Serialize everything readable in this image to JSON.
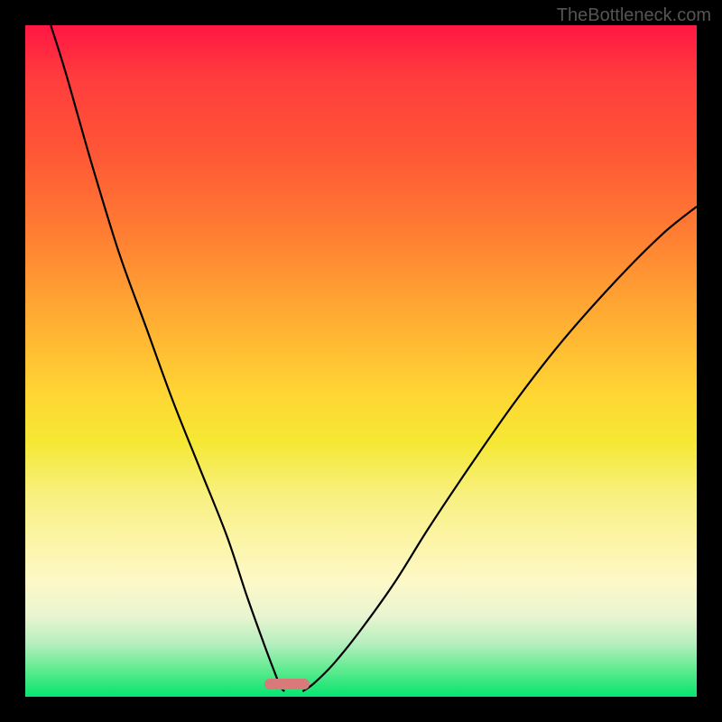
{
  "watermark": "TheBottleneck.com",
  "chart_data": {
    "type": "line",
    "title": "",
    "xlabel": "",
    "ylabel": "",
    "xlim": [
      0,
      100
    ],
    "ylim": [
      0,
      100
    ],
    "optimal_x": 39,
    "series": [
      {
        "name": "left-curve",
        "x": [
          3.8,
          6,
          10,
          14,
          18,
          22,
          26,
          30,
          33,
          35.5,
          37,
          38,
          38.6
        ],
        "y": [
          100,
          93,
          79,
          66,
          55,
          44,
          34,
          24,
          15,
          8,
          4,
          1.5,
          0.8
        ]
      },
      {
        "name": "right-curve",
        "x": [
          41.3,
          43,
          46,
          50,
          55,
          60,
          66,
          73,
          80,
          88,
          95,
          100
        ],
        "y": [
          0.8,
          2,
          5,
          10,
          17,
          25,
          34,
          44,
          53,
          62,
          69,
          73
        ]
      }
    ],
    "marker": {
      "x": 39,
      "width_pct": 6.7,
      "color": "#d87a7a"
    },
    "gradient_stops": [
      {
        "pct": 0,
        "color": "#ff1744"
      },
      {
        "pct": 50,
        "color": "#ffd633"
      },
      {
        "pct": 100,
        "color": "#00e676"
      }
    ]
  },
  "layout": {
    "plot_size": 744,
    "plot_offset": 28
  }
}
